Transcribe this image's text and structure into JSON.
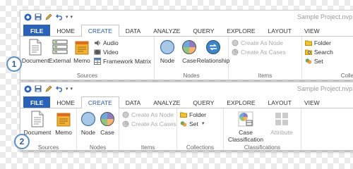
{
  "window1": {
    "title": "Sample Project.nvp",
    "qat_dropdown": "▾",
    "tabs": [
      "FILE",
      "HOME",
      "CREATE",
      "DATA",
      "ANALYZE",
      "QUERY",
      "EXPLORE",
      "LAYOUT",
      "VIEW"
    ],
    "active_tab_index": 2,
    "groups": {
      "sources": {
        "label": "Sources",
        "document": "Document",
        "external": "External",
        "memo": "Memo",
        "audio": "Audio",
        "video": "Video",
        "framework_matrix": "Framework Matrix"
      },
      "nodes": {
        "label": "Nodes",
        "node": "Node",
        "case": "Case",
        "relationship": "Relationship"
      },
      "items": {
        "label": "Items",
        "create_as_node": "Create As Node",
        "create_as_cases": "Create As Cases"
      },
      "collections": {
        "label": "Collec",
        "folder": "Folder",
        "search": "Search",
        "set": "Set"
      }
    }
  },
  "window2": {
    "title": "Sample Project.nvp",
    "qat_dropdown": "▾",
    "tabs": [
      "FILE",
      "HOME",
      "CREATE",
      "DATA",
      "ANALYZE",
      "QUERY",
      "EXPLORE",
      "LAYOUT",
      "VIEW"
    ],
    "active_tab_index": 2,
    "groups": {
      "sources": {
        "label": "Sources",
        "document": "Document",
        "memo": "Memo"
      },
      "nodes": {
        "label": "Nodes",
        "node": "Node",
        "case": "Case"
      },
      "items": {
        "label": "Items",
        "create_as_node": "Create As Node",
        "create_as_cases": "Create As Cases"
      },
      "collections": {
        "label": "Collections",
        "folder": "Folder",
        "set": "Set"
      },
      "classifications": {
        "label": "Classifications",
        "case_classification_line1": "Case",
        "case_classification_line2": "Classification",
        "attribute": "Attribute"
      }
    }
  },
  "callouts": [
    "1",
    "2"
  ],
  "colors": {
    "accent": "#2b62b9",
    "active_tab_text": "#2a5cab",
    "badge_border": "#5a8fc4",
    "node_fill": "#a9c8e8",
    "disabled_text": "#aaaaaa"
  }
}
